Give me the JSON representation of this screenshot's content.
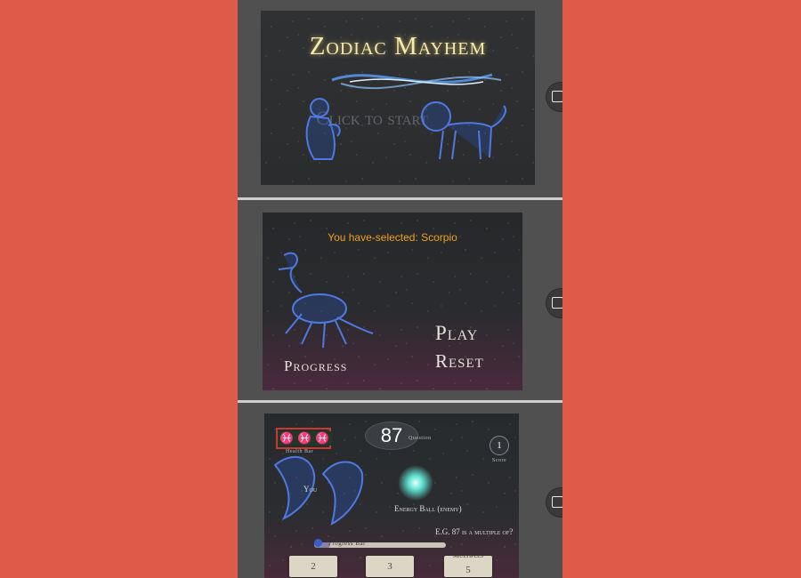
{
  "screens": {
    "title_screen": {
      "title": "Zodiac Mayhem",
      "start_text": "Click to start"
    },
    "select_screen": {
      "selected_text": "You have-selected: Scorpio",
      "play_label": "Play",
      "reset_label": "Reset",
      "progress_label": "Progress"
    },
    "battle_screen": {
      "health_icons": [
        "♓",
        "♓",
        "♓"
      ],
      "health_label": "Health Bar",
      "question_number": "87",
      "question_label": "Question",
      "score_value": "1",
      "score_label": "Score",
      "player_label": "You",
      "enemy_label": "Energy Ball (enemy)",
      "prompt_text": "E.G. 87 is a multiple of?",
      "progress_bar_label": "Progress Bar",
      "progress_fraction": 0.12,
      "answers": [
        "2",
        "3",
        "5"
      ],
      "multiples_label": "Multiples"
    }
  },
  "colors": {
    "background": "#e05a48",
    "title_gold": "#f4e9b0",
    "selected_orange": "#f0a020",
    "constellation_blue": "#4f78e0",
    "health_green": "#2fbf4a",
    "health_border": "#c83a30",
    "energy_ball": "#5fe0d0"
  },
  "icons": {
    "home_button": "home-button-icon",
    "constellation_1": "aquarius-constellation-icon",
    "constellation_2": "leo-constellation-icon",
    "constellation_3": "scorpio-constellation-icon",
    "constellation_4": "pisces-constellation-icon",
    "energy_ball": "energy-ball-icon"
  }
}
